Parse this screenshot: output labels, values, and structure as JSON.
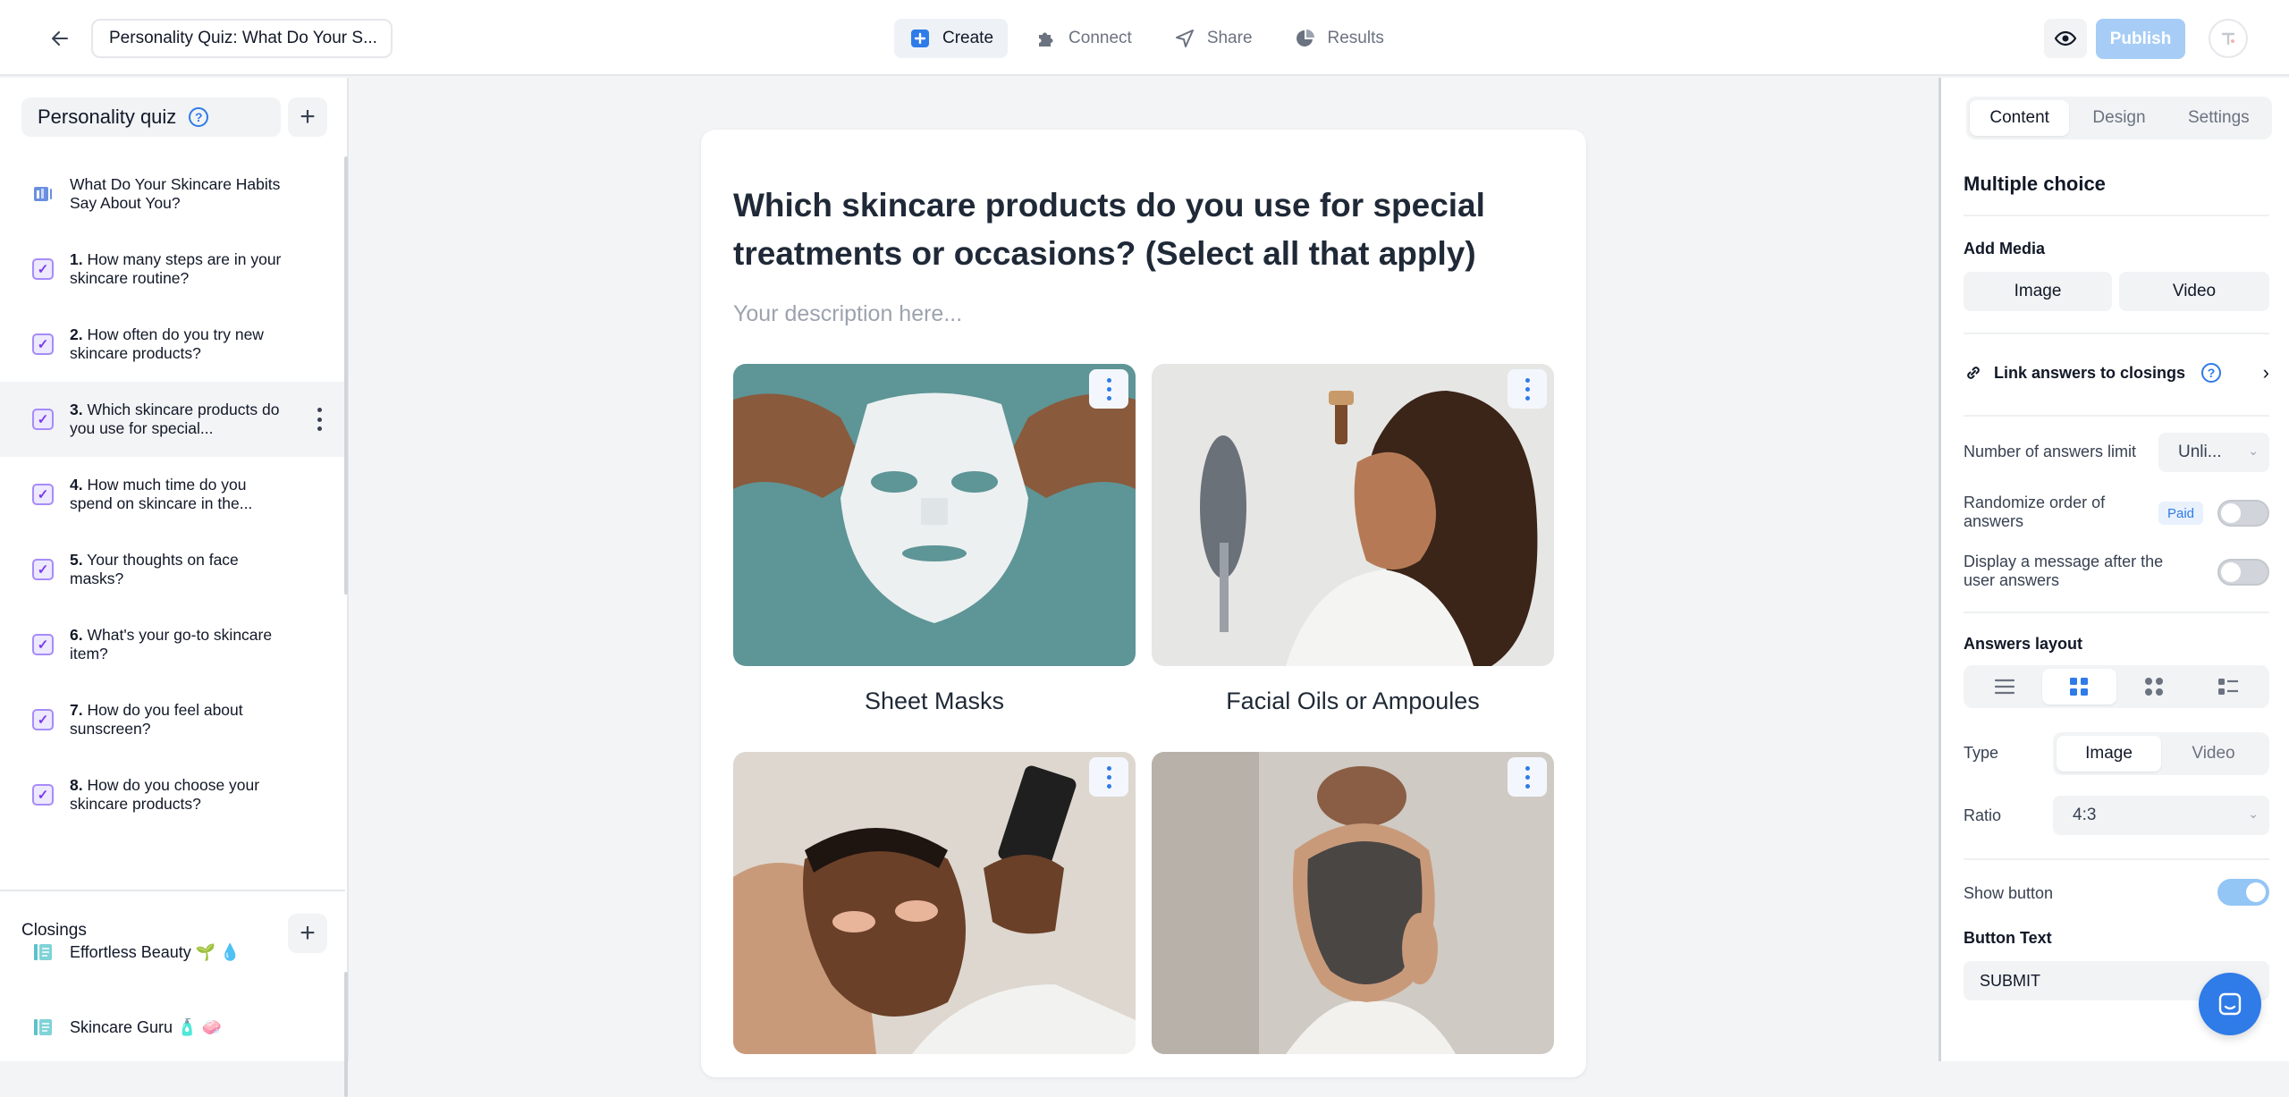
{
  "topbar": {
    "quiz_title": "Personality Quiz: What Do Your S...",
    "nav": [
      {
        "label": "Create",
        "icon": "plus-square-icon"
      },
      {
        "label": "Connect",
        "icon": "puzzle-icon"
      },
      {
        "label": "Share",
        "icon": "send-icon"
      },
      {
        "label": "Results",
        "icon": "pie-chart-icon"
      }
    ],
    "publish_label": "Publish"
  },
  "sidebar": {
    "header": "Personality quiz",
    "help": "?",
    "intro": "What Do Your Skincare Habits Say About You?",
    "questions": [
      {
        "num": "1.",
        "text": "How many steps are in your skincare routine?"
      },
      {
        "num": "2.",
        "text": "How often do you try new skincare products?"
      },
      {
        "num": "3.",
        "text": "Which skincare products do you use for special..."
      },
      {
        "num": "4.",
        "text": "How much time do you spend on skincare in the..."
      },
      {
        "num": "5.",
        "text": "Your thoughts on face masks?"
      },
      {
        "num": "6.",
        "text": "What's your go-to skincare item?"
      },
      {
        "num": "7.",
        "text": "How do you feel about sunscreen?"
      },
      {
        "num": "8.",
        "text": "How do you choose your skincare products?"
      }
    ],
    "closings_label": "Closings",
    "closings": [
      {
        "text": "Effortless Beauty 🌱 💧"
      },
      {
        "text": "Skincare Guru 🧴 🧼"
      }
    ]
  },
  "question": {
    "title": "Which skincare products do you use for special treatments or occasions? (Select all that apply)",
    "description_placeholder": "Your description here...",
    "options": [
      {
        "label": "Sheet Masks",
        "image": "sheet-mask-photo"
      },
      {
        "label": "Facial Oils or Ampoules",
        "image": "facial-oil-photo"
      },
      {
        "label": "",
        "image": "eye-patches-photo"
      },
      {
        "label": "",
        "image": "clay-mask-photo"
      }
    ]
  },
  "panel": {
    "tabs": [
      "Content",
      "Design",
      "Settings"
    ],
    "section_title": "Multiple choice",
    "add_media_label": "Add Media",
    "image_btn": "Image",
    "video_btn": "Video",
    "link_answers": "Link answers to closings",
    "answers_limit_label": "Number of answers limit",
    "answers_limit_value": "Unli...",
    "randomize_label": "Randomize order of answers",
    "paid_badge": "Paid",
    "display_message_label": "Display a message after the user answers",
    "answers_layout_label": "Answers layout",
    "type_label": "Type",
    "type_options": [
      "Image",
      "Video"
    ],
    "ratio_label": "Ratio",
    "ratio_value": "4:3",
    "show_button_label": "Show button",
    "button_text_label": "Button Text",
    "button_text_value": "SUBMIT"
  },
  "colors": {
    "accent": "#2f7be8",
    "publish_disabled": "#a7cdf6",
    "check_purple": "#7c3aed"
  }
}
